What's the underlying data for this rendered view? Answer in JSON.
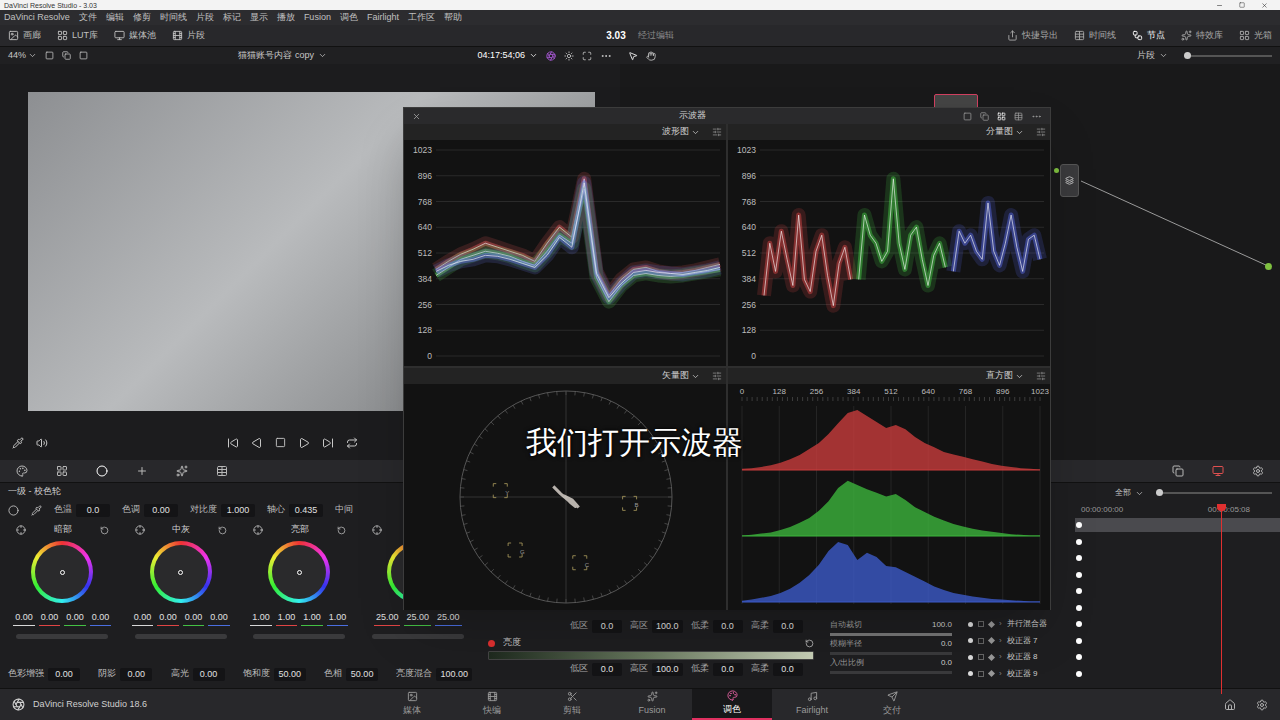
{
  "window": {
    "title": "DaVinci Resolve Studio - 3.03"
  },
  "menu": [
    "DaVinci Resolve",
    "文件",
    "编辑",
    "修剪",
    "时间线",
    "片段",
    "标记",
    "显示",
    "播放",
    "Fusion",
    "调色",
    "Fairlight",
    "工作区",
    "帮助"
  ],
  "toolbar": {
    "left": [
      "画廊",
      "LUT库",
      "媒体池",
      "片段"
    ],
    "project": "3.03",
    "status": "经过编辑",
    "right": [
      {
        "label": "快捷导出",
        "selected": false
      },
      {
        "label": "时间线",
        "selected": false
      },
      {
        "label": "节点",
        "selected": true
      },
      {
        "label": "特效库",
        "selected": false
      },
      {
        "label": "光箱",
        "selected": false
      }
    ]
  },
  "viewer": {
    "zoom": "44%",
    "clip_name": "猫猫账号内容 copy",
    "timecode": "04:17:54;06",
    "node_mode": "片段"
  },
  "scopes": {
    "title": "示波器",
    "waveform": {
      "label": "波形图",
      "ticks": [
        "1023",
        "896",
        "768",
        "640",
        "512",
        "384",
        "256",
        "128",
        "0"
      ],
      "series": [
        {
          "name": "R",
          "color": "#e35a5a",
          "values": [
            430,
            470,
            505,
            530,
            560,
            540,
            520,
            500,
            470,
            560,
            640,
            590,
            880,
            420,
            300,
            380,
            430,
            440,
            420,
            410,
            415,
            425,
            440,
            455
          ]
        },
        {
          "name": "G",
          "color": "#5ad35a",
          "values": [
            400,
            440,
            480,
            500,
            520,
            510,
            495,
            470,
            450,
            520,
            600,
            560,
            830,
            390,
            270,
            350,
            400,
            410,
            400,
            395,
            400,
            410,
            420,
            430
          ]
        },
        {
          "name": "B",
          "color": "#6a7cf0",
          "values": [
            420,
            450,
            470,
            480,
            500,
            495,
            480,
            460,
            440,
            500,
            590,
            540,
            860,
            410,
            290,
            360,
            415,
            425,
            415,
            410,
            405,
            415,
            425,
            440
          ]
        }
      ]
    },
    "parade": {
      "label": "分量图",
      "ticks": [
        "1023",
        "896",
        "768",
        "640",
        "512",
        "384",
        "256",
        "128",
        "0"
      ],
      "series": [
        {
          "name": "R",
          "color": "#e34a4a",
          "values": [
            300,
            560,
            420,
            620,
            480,
            350,
            700,
            380,
            320,
            520,
            600,
            400,
            250,
            460,
            540,
            380
          ]
        },
        {
          "name": "G",
          "color": "#4ad34a",
          "values": [
            380,
            700,
            600,
            560,
            470,
            520,
            880,
            560,
            430,
            600,
            640,
            480,
            350,
            500,
            560,
            440
          ]
        },
        {
          "name": "B",
          "color": "#5a6cf0",
          "values": [
            420,
            620,
            560,
            600,
            520,
            480,
            760,
            520,
            450,
            560,
            700,
            540,
            420,
            580,
            600,
            480
          ]
        }
      ]
    },
    "vectorscope": {
      "label": "矢量图",
      "targets": [
        {
          "label": "Y"
        },
        {
          "label": "B"
        },
        {
          "label": "G"
        },
        {
          "label": "C"
        }
      ],
      "trace": [
        [
          -0.12,
          -0.1
        ],
        [
          -0.05,
          -0.03
        ],
        [
          0.02,
          0.03
        ],
        [
          0.09,
          0.09
        ],
        [
          0.04,
          0.05
        ],
        [
          -0.02,
          -0.01
        ],
        [
          0.06,
          0.03
        ],
        [
          0.12,
          0.1
        ]
      ]
    },
    "histogram": {
      "label": "直方图",
      "ticks": [
        "0",
        "128",
        "256",
        "384",
        "512",
        "640",
        "768",
        "896",
        "1023"
      ],
      "series": [
        {
          "name": "R",
          "color": "#c83c3c",
          "values": [
            2,
            3,
            5,
            8,
            12,
            18,
            25,
            35,
            45,
            60,
            78,
            95,
            100,
            90,
            80,
            70,
            75,
            68,
            55,
            45,
            38,
            30,
            26,
            22,
            18,
            14,
            10,
            7,
            5,
            3,
            2,
            1
          ]
        },
        {
          "name": "G",
          "color": "#3cb43c",
          "values": [
            1,
            2,
            4,
            6,
            10,
            15,
            22,
            30,
            42,
            58,
            80,
            92,
            85,
            78,
            72,
            66,
            70,
            60,
            48,
            40,
            32,
            26,
            20,
            16,
            12,
            9,
            7,
            5,
            3,
            2,
            1,
            1
          ]
        },
        {
          "name": "B",
          "color": "#3c5ac8",
          "values": [
            2,
            4,
            7,
            10,
            15,
            22,
            32,
            45,
            62,
            85,
            100,
            95,
            70,
            82,
            75,
            60,
            58,
            50,
            42,
            34,
            26,
            20,
            15,
            12,
            9,
            7,
            5,
            4,
            3,
            2,
            1,
            1
          ]
        }
      ]
    }
  },
  "subtitle": "我们打开示波器",
  "primaries": {
    "title": "一级 - 校色轮",
    "params": [
      {
        "label": "色温",
        "value": "0.0"
      },
      {
        "label": "色调",
        "value": "0.00"
      },
      {
        "label": "对比度",
        "value": "1.000"
      },
      {
        "label": "轴心",
        "value": "0.435"
      },
      {
        "label": "中间",
        "value": ""
      }
    ],
    "wheels": [
      {
        "label": "暗部",
        "values": [
          "0.00",
          "0.00",
          "0.00",
          "0.00"
        ]
      },
      {
        "label": "中灰",
        "values": [
          "0.00",
          "0.00",
          "0.00",
          "0.00"
        ]
      },
      {
        "label": "亮部",
        "values": [
          "1.00",
          "1.00",
          "1.00",
          "1.00"
        ]
      },
      {
        "label": "",
        "values": [
          "25.00",
          "25.00",
          "25.00"
        ]
      }
    ],
    "bottom_params": [
      {
        "label": "色彩增强",
        "value": "0.00"
      },
      {
        "label": "阴影",
        "value": "0.00"
      },
      {
        "label": "高光",
        "value": "0.00"
      },
      {
        "label": "饱和度",
        "value": "50.00"
      },
      {
        "label": "色相",
        "value": "50.00"
      },
      {
        "label": "亮度混合",
        "value": "100.00"
      }
    ]
  },
  "qualifier": {
    "upper": [
      {
        "label": "低区",
        "value": "0.0"
      },
      {
        "label": "高区",
        "value": "100.0"
      },
      {
        "label": "低柔",
        "value": "0.0"
      },
      {
        "label": "高柔",
        "value": "0.0"
      }
    ],
    "channel": {
      "label": "亮度",
      "on": true
    },
    "lower": [
      {
        "label": "低区",
        "value": "0.0"
      },
      {
        "label": "高区",
        "value": "100.0"
      },
      {
        "label": "低柔",
        "value": "0.0"
      },
      {
        "label": "高柔",
        "value": "0.0"
      }
    ]
  },
  "blur": [
    {
      "label": "自动裁切",
      "value": "100.0",
      "level": 1
    },
    {
      "label": "模糊半径",
      "value": "0.0",
      "level": 0
    },
    {
      "label": "入/出比例",
      "value": "0.0",
      "level": 0
    }
  ],
  "keyframes": {
    "filter": "全部",
    "start": "00:00:00:00",
    "end": "00:00:05:08",
    "rows": [
      {
        "name": "",
        "selected": true
      },
      {
        "name": "",
        "selected": false
      },
      {
        "name": "",
        "selected": false
      },
      {
        "name": "",
        "selected": false
      },
      {
        "name": "",
        "selected": false
      },
      {
        "name": "",
        "selected": false
      },
      {
        "name": "并行混合器",
        "selected": false
      },
      {
        "name": "校正器 7",
        "selected": false
      },
      {
        "name": "校正器 8",
        "selected": false
      },
      {
        "name": "校正器 9",
        "selected": false
      }
    ]
  },
  "pages": {
    "brand": "DaVinci Resolve Studio 18.6",
    "tabs": [
      {
        "label": "媒体",
        "selected": false
      },
      {
        "label": "快编",
        "selected": false
      },
      {
        "label": "剪辑",
        "selected": false
      },
      {
        "label": "Fusion",
        "selected": false
      },
      {
        "label": "调色",
        "selected": true
      },
      {
        "label": "Fairlight",
        "selected": false
      },
      {
        "label": "交付",
        "selected": false
      }
    ]
  }
}
